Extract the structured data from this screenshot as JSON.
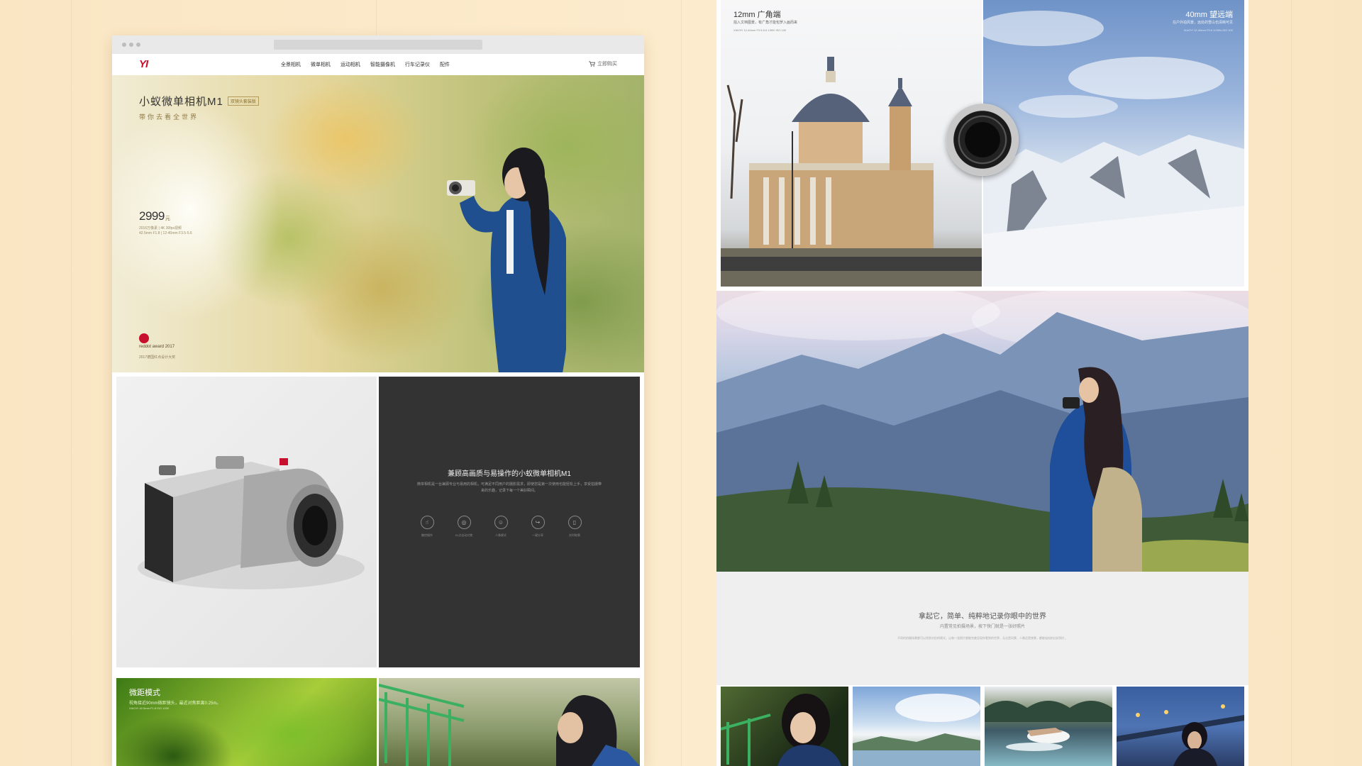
{
  "left_page": {
    "logo": "YI",
    "nav": [
      "全景相机",
      "微单相机",
      "运动相机",
      "智能摄像机",
      "行车记录仪",
      "配件"
    ],
    "cart_label": "立即购买",
    "hero": {
      "title": "小蚁微单相机M1",
      "badge": "双镜头套装版",
      "subtitle": "带你去看全世界",
      "price": "2999",
      "price_unit": "元",
      "spec_line1": "2016万像素 | 4K 30fps视频",
      "spec_line2": "42.5mm F1.8 | 12-40mm F3.5-5.6",
      "award": "reddot award 2017",
      "award_sub": "2017德国红点设计大奖"
    },
    "intro": {
      "title": "兼顾高画质与易操作的小蚁微单相机M1",
      "body": "微单相机是一台兼顾专业与易用的相机，可满足不同用户的摄影需求，即使您是第一次使用也能轻松上手，享受拍摄带来的乐趣，记录下每一个美好瞬间。",
      "features": [
        "触控操作",
        "81点自动对焦",
        "人像模式",
        "一键分享",
        "实时取景"
      ]
    },
    "macro": {
      "title": "微距模式",
      "subtitle": "视角接近90mm微距镜头，最近对焦距离0.25m。",
      "spec": "XIAOYI 42.5mm F1.8 ISO 1000"
    }
  },
  "right_page": {
    "wide": {
      "title": "12mm 广角端",
      "subtitle": "拍入文档图景，有广角才能包罗入画而来",
      "spec": "XIAOYI 12-40mm F3.5-5.6 1/500 ISO 100"
    },
    "tele": {
      "title": "40mm 望远端",
      "subtitle": "在户外拍风景，远处的雪山也清晰可见",
      "spec": "XIAOYI 12-40mm F5.6 1/250s ISO 100"
    },
    "gray_section": {
      "title": "拿起它，简单、纯粹地记录你眼中的世界",
      "subtitle": "内置常见拍摄场景，按下快门就是一张好照片",
      "body": "不同的拍摄场景都可以找到对应的模式，让每一张照片都能完美呈现你看到的世界，无论是风景、人像还是夜景，都能轻松拍出好照片。"
    }
  },
  "colors": {
    "background": "#fbe9c9",
    "brand_red": "#c8102e",
    "dark_panel": "#333333"
  }
}
